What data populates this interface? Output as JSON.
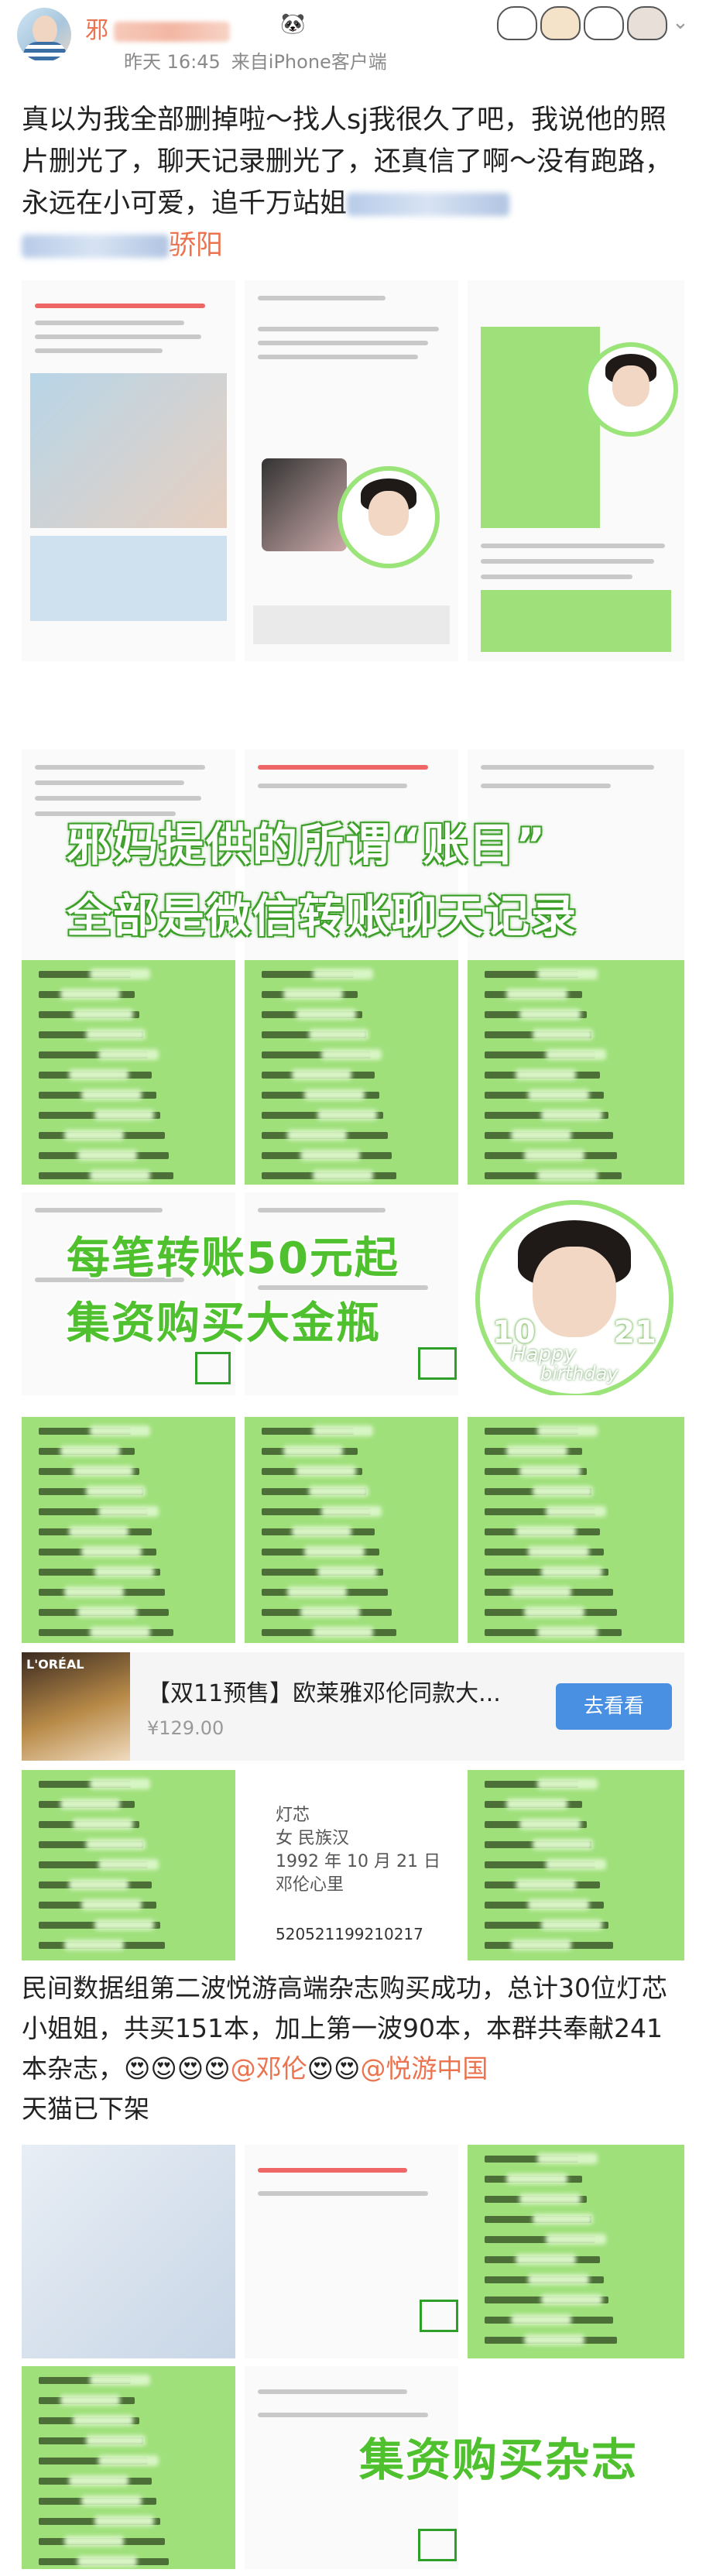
{
  "header": {
    "username_visible": "邪",
    "time": "昨天 16:45",
    "source": "来自iPhone客户端"
  },
  "post": {
    "text": "真以为我全部删掉啦～找人sj我很久了吧，我说他的照片删光了，聊天记录删光了，还真信了啊～没有跑路，永远在小可爱，追千万站姐",
    "mention_end": "骄阳"
  },
  "captions": {
    "ledger": "邪妈提供的所谓“账目”",
    "ledger2": "全部是微信转账聊天记录",
    "transfer": "每笔转账50元起",
    "buy": "集资购买大金瓶",
    "magazine": "集资购买杂志"
  },
  "sticker": {
    "left": "10",
    "right": "21",
    "happy": "Happy",
    "birthday": "birthday"
  },
  "product": {
    "title": "【双11预售】欧莱雅邓伦同款大...",
    "price": "¥129.00",
    "button": "去看看",
    "thumb_label": "L'ORÉAL"
  },
  "idcard": {
    "name_label": "灯芯",
    "nation": "女   民族汉",
    "birth": "1992 年 10 月 21 日",
    "addr": "邓伦心里",
    "id": "520521199210217"
  },
  "post2": {
    "text": "民间数据组第二波悦游高端杂志购买成功，总计30位灯芯小姐姐，共买151本，加上第一波90本，本群共奉献241本杂志，",
    "emoji": "😍😍😍😍",
    "mention1": "@邓伦",
    "emoji2": "😍😍",
    "mention2": "@悦游中国",
    "tail": "天猫已下架"
  },
  "colors": {
    "accent": "#eb7350",
    "green": "#9fe07b",
    "caption_stroke": "#3ea02a",
    "button": "#4a90e2"
  }
}
